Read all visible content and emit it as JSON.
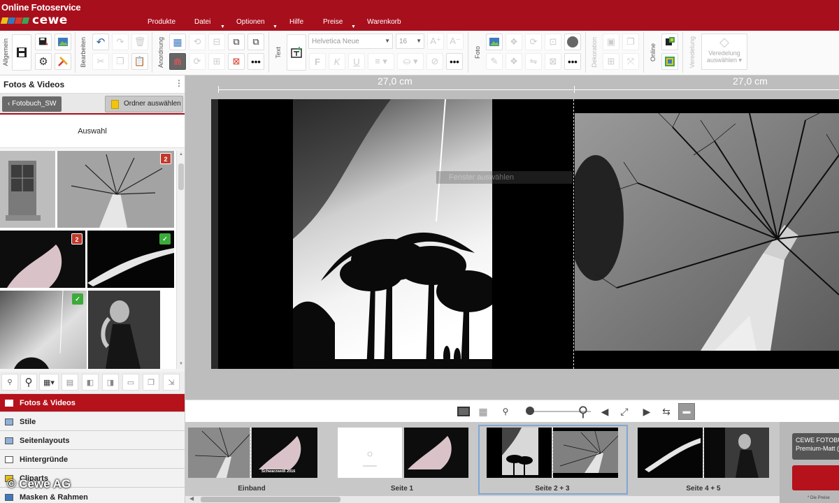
{
  "brand": {
    "line1": "Online Fotoservice",
    "line2": "cewe",
    "colors": {
      "accent": "#a80f1c",
      "sq1": "#e8c21b",
      "sq2": "#2d7bc4",
      "sq3": "#d93a2b",
      "sq4": "#3aa55a"
    }
  },
  "menu": [
    {
      "label": "Produkte",
      "has_dropdown": false
    },
    {
      "label": "Datei",
      "has_dropdown": true
    },
    {
      "label": "Optionen",
      "has_dropdown": true
    },
    {
      "label": "Hilfe",
      "has_dropdown": false
    },
    {
      "label": "Preise",
      "has_dropdown": true
    },
    {
      "label": "Warenkorb",
      "has_dropdown": false
    }
  ],
  "toolbar": {
    "groups": [
      "Allgemein",
      "Bearbeiten",
      "Anordnung",
      "Text",
      "Foto",
      "Dekoration",
      "Online",
      "Veredelung"
    ],
    "font_family": "Helvetica Neue",
    "font_size": "16",
    "veredelung": {
      "line1": "Veredelung",
      "line2": "auswählen"
    }
  },
  "left_panel": {
    "title": "Fotos & Videos",
    "back_label": "Fotobuch_SW",
    "folder_label": "Ordner auswählen",
    "selection_label": "Auswahl",
    "photos": [
      {
        "subject": "door",
        "badge": ""
      },
      {
        "subject": "tree",
        "badge": "2"
      },
      {
        "subject": "body",
        "badge": "2"
      },
      {
        "subject": "arms",
        "badge": "check"
      },
      {
        "subject": "sky",
        "badge": "check"
      },
      {
        "subject": "woman",
        "badge": ""
      }
    ],
    "categories": [
      {
        "label": "Fotos & Videos",
        "active": true
      },
      {
        "label": "Stile",
        "active": false
      },
      {
        "label": "Seitenlayouts",
        "active": false
      },
      {
        "label": "Hintergründe",
        "active": false
      },
      {
        "label": "Cliparts",
        "active": false
      },
      {
        "label": "Masken & Rahmen",
        "active": false
      }
    ]
  },
  "workspace": {
    "ruler_left": "27,0 cm",
    "ruler_right": "27,0 cm",
    "placeholder_hint": "Fenster auswählen"
  },
  "filmstrip": {
    "pages": [
      {
        "label": "Einband",
        "cover_text": "Schwarzweiß 2016",
        "selected": false
      },
      {
        "label": "Seite 1",
        "selected": false
      },
      {
        "label": "Seite 2 + 3",
        "selected": true
      },
      {
        "label": "Seite 4 + 5",
        "selected": false
      }
    ]
  },
  "right_panel": {
    "product_line1": "CEWE FOTOBU",
    "product_line2": "Premium-Matt (2",
    "price_note": "* Die Preise"
  },
  "copyright": "© Cewe AG"
}
